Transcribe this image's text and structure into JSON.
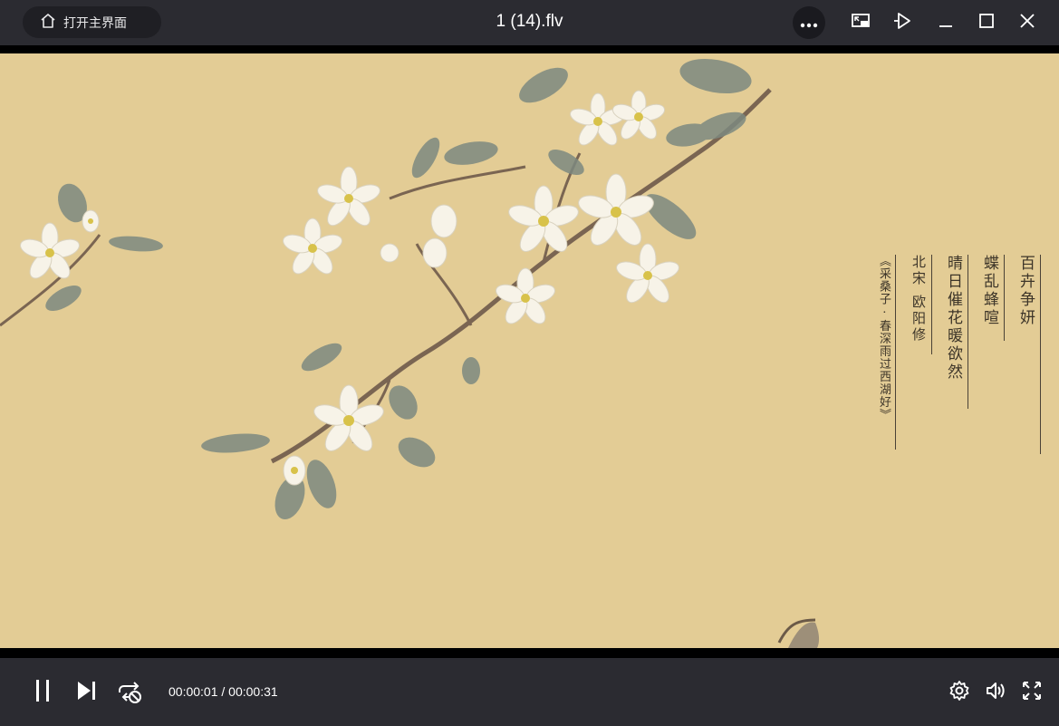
{
  "titlebar": {
    "home_label": "打开主界面",
    "file_title": "1 (14).flv"
  },
  "poem": {
    "line1": "百卉争妍",
    "line2": "蝶乱蜂喧",
    "line3": "晴日催花暖欲然",
    "author": "北宋 欧阳修",
    "source": "《采桑子 · 春深雨过西湖好》"
  },
  "player": {
    "current_time": "00:00:01",
    "separator": "/",
    "total_time": "00:00:31"
  },
  "colors": {
    "chrome": "#2b2b31",
    "video_bg": "#e3cc95"
  },
  "icons": [
    "home-icon",
    "more-icon",
    "picture-in-picture-icon",
    "pin-on-top-icon",
    "minimize-icon",
    "maximize-icon",
    "close-icon",
    "pause-icon",
    "next-icon",
    "loop-off-icon",
    "settings-icon",
    "volume-icon",
    "fullscreen-icon"
  ]
}
